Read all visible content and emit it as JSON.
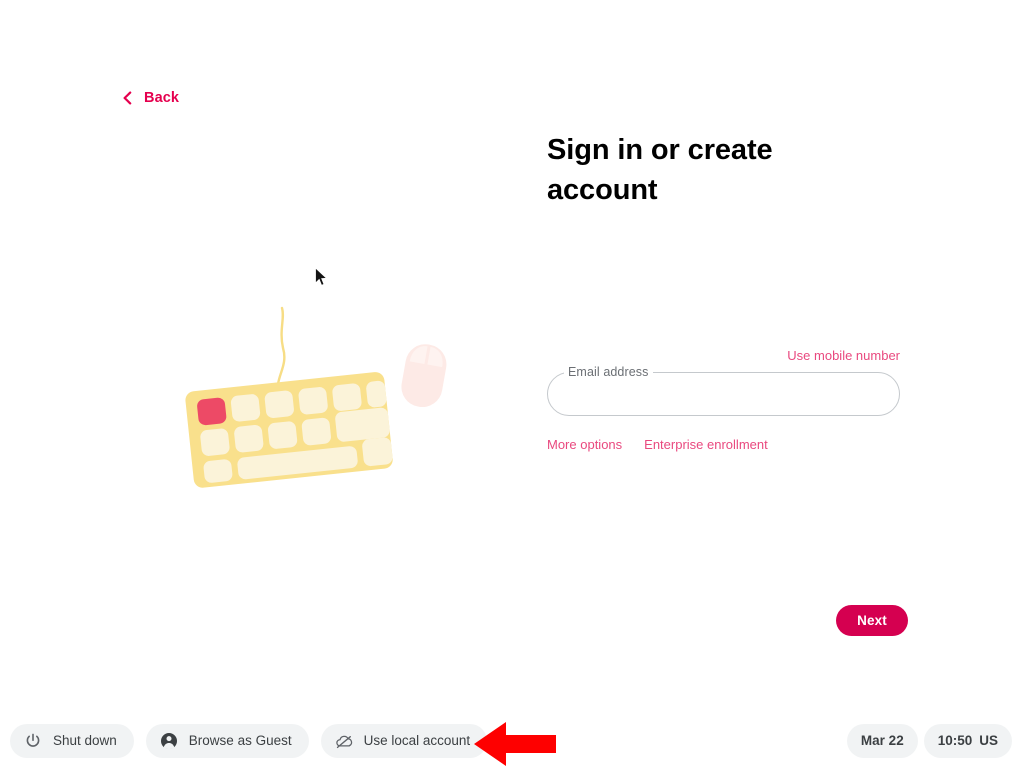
{
  "colors": {
    "accent_pink": "#e9497f",
    "accent_crimson": "#e5004e",
    "button_primary": "#d50050",
    "shelf_pill_bg": "#f1f3f4",
    "text_primary": "#202124",
    "field_border": "#c5c9cd",
    "keyboard_body": "#f9e08c",
    "keyboard_key": "#fbf3d9",
    "keyboard_key_red": "#ed4a66",
    "mouse_body": "#fdeae6",
    "annotation_arrow": "#fe0000"
  },
  "back": {
    "label": "Back",
    "icon": "chevron-left-icon"
  },
  "main": {
    "title": "Sign in or create account",
    "illustration": {
      "name": "keyboard-and-mouse-illustration",
      "items": [
        "keyboard",
        "mouse",
        "cable"
      ]
    },
    "cursor": "mouse-pointer-cursor"
  },
  "form": {
    "use_mobile_link": "Use mobile number",
    "email": {
      "label": "Email address",
      "value": "",
      "placeholder": ""
    },
    "more_options_link": "More options",
    "enterprise_enrollment_link": "Enterprise enrollment",
    "next_button": "Next"
  },
  "shelf": {
    "buttons": [
      {
        "label": "Shut down",
        "icon": "power-icon"
      },
      {
        "label": "Browse as Guest",
        "icon": "person-icon"
      },
      {
        "label": "Use local account",
        "icon": "cloud-off-icon"
      }
    ],
    "status": {
      "date": "Mar 22",
      "time": "10:50",
      "input_method": "US"
    }
  },
  "annotation": {
    "arrow": "red-left-arrow",
    "points_at": "Use local account"
  }
}
